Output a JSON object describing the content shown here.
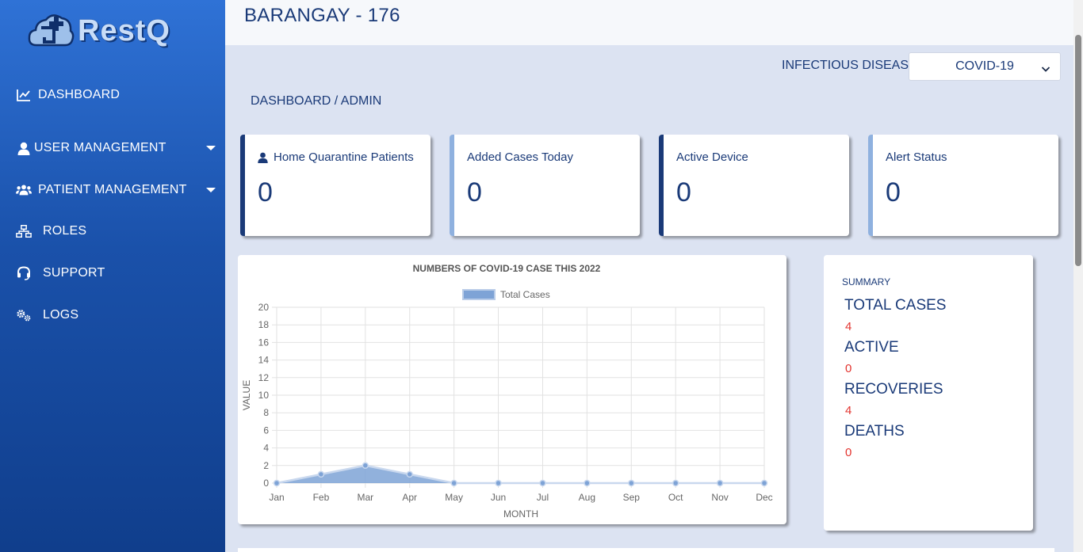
{
  "app": {
    "logo_text": "RestQ"
  },
  "sidebar": {
    "items": [
      {
        "label": "DASHBOARD",
        "icon": "chart-line-icon"
      },
      {
        "label": "USER MANAGEMENT",
        "icon": "user-icon",
        "has_submenu": true
      },
      {
        "label": "PATIENT MANAGEMENT",
        "icon": "users-icon",
        "has_submenu": true
      },
      {
        "label": "ROLES",
        "icon": "sitemap-icon"
      },
      {
        "label": "SUPPORT",
        "icon": "headset-icon"
      },
      {
        "label": "LOGS",
        "icon": "cogs-icon"
      }
    ]
  },
  "header": {
    "title": "BARANGAY - 176"
  },
  "filter": {
    "label": "INFECTIOUS DISEASE",
    "selected": "COVID-19"
  },
  "breadcrumb": "DASHBOARD / ADMIN",
  "cards": [
    {
      "title": "Home Quarantine Patients",
      "value": "0",
      "icon": "user-icon",
      "stripe_color": "#1a3a78"
    },
    {
      "title": "Added Cases Today",
      "value": "0",
      "stripe_color": "#8fb1df"
    },
    {
      "title": "Active Device",
      "value": "0",
      "stripe_color": "#1a3a78"
    },
    {
      "title": "Alert Status",
      "value": "0",
      "stripe_color": "#8fb1df"
    }
  ],
  "chart_data": {
    "type": "area",
    "title": "NUMBERS OF COVID-19 CASE THIS 2022",
    "xlabel": "MONTH",
    "ylabel": "VALUE",
    "categories": [
      "Jan",
      "Feb",
      "Mar",
      "Apr",
      "May",
      "Jun",
      "Jul",
      "Aug",
      "Sep",
      "Oct",
      "Nov",
      "Dec"
    ],
    "series": [
      {
        "name": "Total Cases",
        "values": [
          0,
          1,
          2,
          1,
          0,
          0,
          0,
          0,
          0,
          0,
          0,
          0
        ],
        "color": "#7ea3d6"
      }
    ],
    "ylim": [
      0,
      20
    ],
    "yticks": [
      "0",
      "2",
      "4",
      "6",
      "8",
      "10",
      "12",
      "14",
      "16",
      "18",
      "20"
    ],
    "grid": true,
    "legend": "top"
  },
  "summary": {
    "heading": "SUMMARY",
    "items": [
      {
        "label": "TOTAL CASES",
        "value": "4"
      },
      {
        "label": "ACTIVE",
        "value": "0"
      },
      {
        "label": "RECOVERIES",
        "value": "4"
      },
      {
        "label": "DEATHS",
        "value": "0"
      }
    ]
  },
  "colors": {
    "primary": "#1a3a78",
    "accent": "#e3342f",
    "sidebar": "#1a51aa"
  }
}
